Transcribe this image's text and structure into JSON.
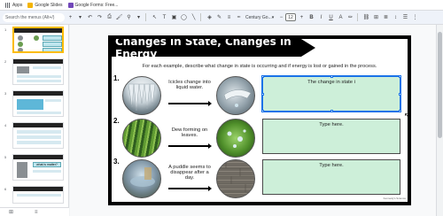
{
  "bookmarks": [
    {
      "label": "Apps",
      "color": "#5f6368"
    },
    {
      "label": "Google Slides",
      "color": "#f4b400"
    },
    {
      "label": "Google Forms: Free...",
      "color": "#7248b9"
    }
  ],
  "toolbar": {
    "search_placeholder": "Search the menus (Alt+/)",
    "font": "Century Go...",
    "font_size": "12"
  },
  "filmstrip": {
    "slide_numbers": [
      "1",
      "2",
      "3",
      "4",
      "5",
      "6"
    ],
    "selected_index": 0,
    "thumb5_text": "what is matter?"
  },
  "slide": {
    "title": "Changes in State, Changes in Energy",
    "instructions": "For each example, describe what change in state is occurring and if energy is lost or gained in the process.",
    "rows": [
      {
        "num": "1.",
        "label": "Icicles change into liquid water.",
        "answer": "The change in state i"
      },
      {
        "num": "2.",
        "label": "Dew forming on leaves.",
        "answer": "Type here."
      },
      {
        "num": "3.",
        "label": "A puddle seems to disappear after a day.",
        "answer": "Type here."
      }
    ],
    "credit": "Kennedy's Science"
  },
  "colors": {
    "answer_box": "#cdefd9",
    "selection": "#1a73e8",
    "ribbon": "#000000"
  }
}
